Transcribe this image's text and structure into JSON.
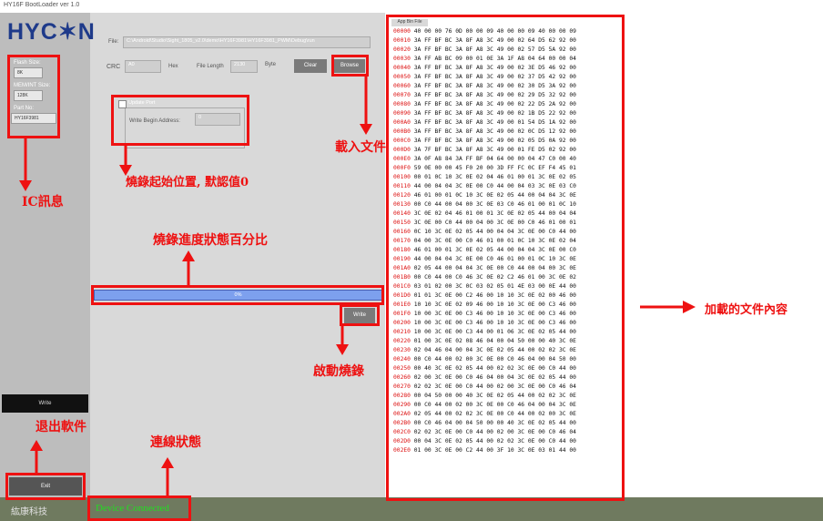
{
  "window_title": "HY16F BootLoader ver 1.0",
  "logo": "HYC✶N",
  "sidebar": {
    "flash_size_label": "Flash Size:",
    "flash_size_value": "8K",
    "memory_size_label": "MEM/INT Size:",
    "memory_size_value": "128K",
    "part_no_label": "Part No:",
    "part_no_value": "HY16F3981",
    "write_button": "Write",
    "exit_button": "Exit"
  },
  "main": {
    "file_label": "File:",
    "file_path": "C:\\Android\\Studio\\Sight_1805_v2.0\\demo\\HY16F3981\\HY16F3981_PWM\\Debug\\run",
    "crc_label": "CRC",
    "crc_value": "A0",
    "crc_unit": "Hex",
    "file_length_label": "File Length",
    "file_length_value": "2130",
    "file_length_unit": "Byte",
    "clear_button": "Clear",
    "browse_button": "Browse",
    "update_port_label": "Update Port",
    "write_begin_label": "Write Begin Address:",
    "write_begin_value": "0",
    "progress_text": "0%",
    "write_button": "Write"
  },
  "hex_panel": {
    "tab_label": "App Bin File",
    "rows": [
      {
        "addr": "00000",
        "bytes": "40 00 00 76 0D 00 00 09 40 00 00 09 40 00 00 09"
      },
      {
        "addr": "00010",
        "bytes": "3A FF BF BC 3A 8F A8 3C 49 00 02 64 D5 62 92 00"
      },
      {
        "addr": "00020",
        "bytes": "3A FF BF BC 3A 8F A8 3C 49 00 02 57 D5 5A 92 00"
      },
      {
        "addr": "00030",
        "bytes": "3A FF AB BC 09 00 01 0E 3A 1F A8 04 64 00 00 04"
      },
      {
        "addr": "00040",
        "bytes": "3A FF BF BC 3A 8F A8 3C 49 00 02 3E D5 46 92 00"
      },
      {
        "addr": "00050",
        "bytes": "3A FF BF BC 3A 8F A8 3C 49 00 02 37 D5 42 92 00"
      },
      {
        "addr": "00060",
        "bytes": "3A FF BF BC 3A 8F A8 3C 49 00 02 30 D5 3A 92 00"
      },
      {
        "addr": "00070",
        "bytes": "3A FF BF BC 3A 8F A8 3C 49 00 02 29 D5 32 92 00"
      },
      {
        "addr": "00080",
        "bytes": "3A FF BF BC 3A 8F A8 3C 49 00 02 22 D5 2A 92 00"
      },
      {
        "addr": "00090",
        "bytes": "3A FF BF BC 3A 8F A8 3C 49 00 02 1B D5 22 92 00"
      },
      {
        "addr": "000A0",
        "bytes": "3A FF BF BC 3A 8F A8 3C 49 00 01 54 D5 1A 92 00"
      },
      {
        "addr": "000B0",
        "bytes": "3A FF BF BC 3A 8F A8 3C 49 00 02 0C D5 12 92 00"
      },
      {
        "addr": "000C0",
        "bytes": "3A FF BF BC 3A 8F A8 3C 49 00 02 05 D5 0A 92 00"
      },
      {
        "addr": "000D0",
        "bytes": "3A 7F BF BC 3A 8F A8 3C 49 00 01 FE D5 02 92 00"
      },
      {
        "addr": "000E0",
        "bytes": "3A 0F A8 84 3A FF BF 04 64 00 00 04 47 C0 00 40"
      },
      {
        "addr": "000F0",
        "bytes": "59 0E 00 00 45 F0 20 00 3D FF FC 0C EF F4 45 01"
      },
      {
        "addr": "00100",
        "bytes": "00 01 0C 10 3C 0E 02 04 46 01 00 01 3C 0E 02 05"
      },
      {
        "addr": "00110",
        "bytes": "44 00 04 04 3C 0E 00 C0 44 00 04 03 3C 0E 03 C0"
      },
      {
        "addr": "00120",
        "bytes": "46 01 00 01 0C 10 3C 0E 02 05 44 00 04 04 3C 0E"
      },
      {
        "addr": "00130",
        "bytes": "00 C0 44 00 04 00 3C 0E 03 C0 46 01 00 01 0C 10"
      },
      {
        "addr": "00140",
        "bytes": "3C 0E 02 04 46 01 00 01 3C 0E 02 05 44 00 04 04"
      },
      {
        "addr": "00150",
        "bytes": "3C 0E 00 C0 44 00 04 00 3C 0E 00 C0 46 01 00 01"
      },
      {
        "addr": "00160",
        "bytes": "0C 10 3C 0E 02 05 44 00 04 04 3C 0E 00 C0 44 00"
      },
      {
        "addr": "00170",
        "bytes": "04 00 3C 0E 00 C0 46 01 00 01 0C 10 3C 0E 02 04"
      },
      {
        "addr": "00180",
        "bytes": "46 01 00 01 3C 0E 02 05 44 00 04 04 3C 0E 00 C0"
      },
      {
        "addr": "00190",
        "bytes": "44 00 04 04 3C 0E 00 C0 46 01 00 01 0C 10 3C 0E"
      },
      {
        "addr": "001A0",
        "bytes": "02 05 44 00 04 04 3C 0E 00 C0 44 00 04 00 3C 0E"
      },
      {
        "addr": "001B0",
        "bytes": "00 C0 44 00 C0 46 3C 0E 02 C2 46 01 00 3C 0E 02"
      },
      {
        "addr": "001C0",
        "bytes": "03 01 02 00 3C 0C 03 02 05 01 4E 03 00 0E 44 00"
      },
      {
        "addr": "001D0",
        "bytes": "01 01 3C 0E 00 C2 46 00 10 10 3C 0E 02 00 46 00"
      },
      {
        "addr": "001E0",
        "bytes": "10 10 3C 0E 02 09 46 00 10 10 3C 0E 00 C3 46 00"
      },
      {
        "addr": "001F0",
        "bytes": "10 00 3C 0E 00 C3 46 00 10 10 3C 0E 00 C3 46 00"
      },
      {
        "addr": "00200",
        "bytes": "10 00 3C 0E 00 C3 46 00 10 10 3C 0E 00 C3 46 00"
      },
      {
        "addr": "00210",
        "bytes": "10 00 3C 0E 00 C3 44 00 01 06 3C 0E 02 05 44 00"
      },
      {
        "addr": "00220",
        "bytes": "01 00 3C 0E 02 08 46 04 00 04 50 00 00 40 3C 0E"
      },
      {
        "addr": "00230",
        "bytes": "02 04 46 04 00 04 3C 0E 02 05 44 00 02 02 3C 0E"
      },
      {
        "addr": "00240",
        "bytes": "00 C0 44 00 02 00 3C 0E 00 C0 46 04 00 04 50 00"
      },
      {
        "addr": "00250",
        "bytes": "00 40 3C 0E 02 05 44 00 02 02 3C 0E 00 C0 44 00"
      },
      {
        "addr": "00260",
        "bytes": "02 00 3C 0E 00 C0 46 04 00 04 3C 0E 02 05 44 00"
      },
      {
        "addr": "00270",
        "bytes": "02 02 3C 0E 00 C0 44 00 02 00 3C 0E 00 C0 46 04"
      },
      {
        "addr": "00280",
        "bytes": "00 04 50 00 00 40 3C 0E 02 05 44 00 02 02 3C 0E"
      },
      {
        "addr": "00290",
        "bytes": "00 C0 44 00 02 00 3C 0E 00 C0 46 04 00 04 3C 0E"
      },
      {
        "addr": "002A0",
        "bytes": "02 05 44 00 02 02 3C 0E 00 C0 44 00 02 00 3C 0E"
      },
      {
        "addr": "002B0",
        "bytes": "00 C0 46 04 00 04 50 00 00 40 3C 0E 02 05 44 00"
      },
      {
        "addr": "002C0",
        "bytes": "02 02 3C 0E 00 C0 44 00 02 00 3C 0E 00 C0 46 04"
      },
      {
        "addr": "002D0",
        "bytes": "00 04 3C 0E 02 05 44 00 02 02 3C 0E 00 C0 44 00"
      },
      {
        "addr": "002E0",
        "bytes": "01 00 3C 0E 00 C2 44 00 3F 10 3C 0E 03 01 44 00"
      }
    ]
  },
  "status": {
    "company": "紘康科技",
    "connection": "Device Connected"
  },
  "annotations": {
    "load_file": "載入文件",
    "burn_start": "燒錄起始位置, 默認值0",
    "ic_info": "IC訊息",
    "progress_status": "燒錄進度狀態百分比",
    "start_burn": "啟動燒錄",
    "exit_software": "退出軟件",
    "connection_status": "連線狀態",
    "loaded_content": "加載的文件內容"
  },
  "colors": {
    "annotation_red": "#ee1111",
    "progress_blue": "#7da0ee",
    "status_green": "#22dd22",
    "logo_blue": "#1e3a8a"
  }
}
